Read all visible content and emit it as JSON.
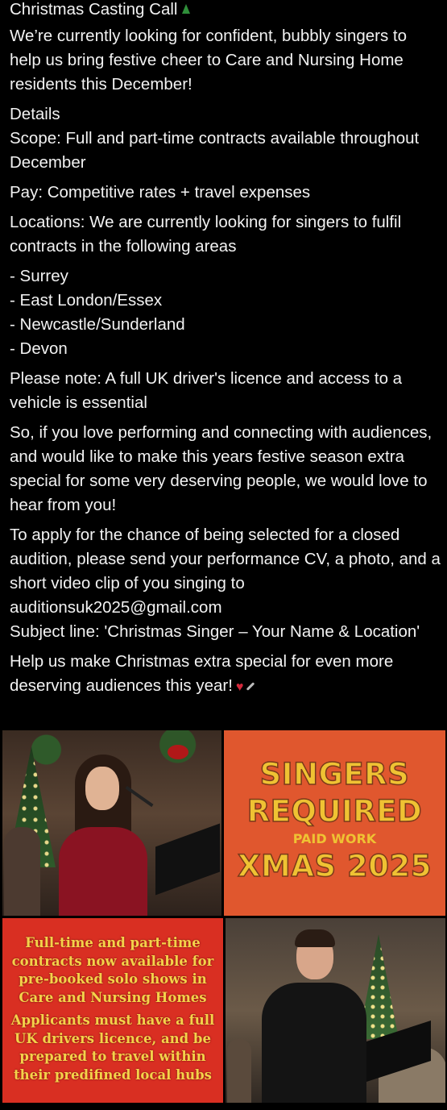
{
  "post": {
    "title": "Christmas Casting Call",
    "intro": "We’re currently looking for confident, bubbly singers to help us bring festive cheer to Care and Nursing Home residents this December!",
    "details_heading": "Details",
    "scope": "Scope: Full and part-time contracts available throughout December",
    "pay": "Pay: Competitive rates + travel expenses",
    "locations_intro": "Locations: We are currently looking for singers to fulfil contracts in the following areas",
    "locations": [
      "- Surrey",
      "- East London/Essex",
      "- Newcastle/Sunderland",
      "- Devon"
    ],
    "note": "Please note: A full UK driver's licence and access to a vehicle is essential",
    "pitch": "So, if you love performing and connecting with audiences, and would like to make this years festive season extra special for some very deserving people, we would love to hear from you!",
    "apply": "To apply for the chance of being selected for a closed audition, please send your performance CV, a photo, and a short video clip of you singing to auditionsuk2025@gmail.com",
    "subject": "Subject line: 'Christmas Singer – Your Name & Location'",
    "closing": "Help us make Christmas extra special for even more deserving audiences this year!",
    "emoji_icons": [
      "tree-icon",
      "heart-icon",
      "microphone-icon"
    ]
  },
  "poster_orange": {
    "line1": "SINGERS",
    "line2": "REQUIRED",
    "line3": "PAID WORK",
    "line4": "XMAS 2025"
  },
  "poster_red": {
    "para1": "Full-time and part-time contracts now available for pre-booked solo shows in Care and Nursing Homes",
    "para2": "Applicants must have a full UK drivers licence, and be prepared to travel within their predifined local hubs"
  },
  "colors": {
    "background": "#000000",
    "text": "#f2f2f2",
    "poster_orange": "#e0572e",
    "poster_red": "#d92f22",
    "poster_text": "#efc233"
  }
}
